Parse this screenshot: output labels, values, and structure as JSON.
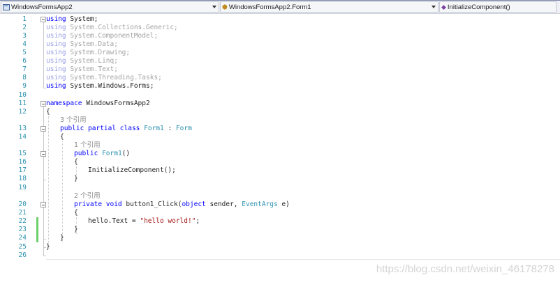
{
  "navbar": {
    "project": "WindowsFormsApp2",
    "class": "WindowsFormsApp2.Form1",
    "member": "InitializeComponent()"
  },
  "editor": {
    "line_numbers": [
      "1",
      "2",
      "3",
      "4",
      "5",
      "6",
      "7",
      "8",
      "9",
      "10",
      "11",
      "12",
      "13",
      "14",
      "15",
      "16",
      "17",
      "18",
      "19",
      "20",
      "21",
      "22",
      "23",
      "24",
      "25",
      "26"
    ],
    "usings": {
      "kw": "using",
      "l1": " System;",
      "l2": " System.Collections.Generic;",
      "l3": " System.ComponentModel;",
      "l4": " System.Data;",
      "l5": " System.Drawing;",
      "l6": " System.Linq;",
      "l7": " System.Text;",
      "l8": " System.Threading.Tasks;",
      "l9": " System.Windows.Forms;"
    },
    "namespace_kw": "namespace",
    "namespace_name": " WindowsFormsApp2",
    "brace_open": "{",
    "brace_close": "}",
    "codelens_class": "3 个引用",
    "class_kw": "public partial class",
    "class_name": "Form1",
    "class_colon": " : ",
    "class_base": "Form",
    "codelens_ctor": "1 个引用",
    "ctor_kw": "public",
    "ctor_name": "Form1",
    "ctor_parens": "()",
    "init_call": "InitializeComponent();",
    "codelens_method": "2 个引用",
    "method_kw": "private void",
    "method_name": " button1_Click(",
    "param1_type": "object",
    "param1_name": " sender, ",
    "param2_type": "EventArgs",
    "param2_name": " e)",
    "stmt_target": "hello.Text = ",
    "stmt_string": "\"hello world!\"",
    "stmt_end": ";"
  },
  "watermark": "https://blog.csdn.net/weixin_46178278",
  "colors": {
    "keyword": "#0000ff",
    "type": "#2b91af",
    "string": "#a31515",
    "line_number": "#2b91af",
    "change_bar": "#6ccf6c"
  }
}
